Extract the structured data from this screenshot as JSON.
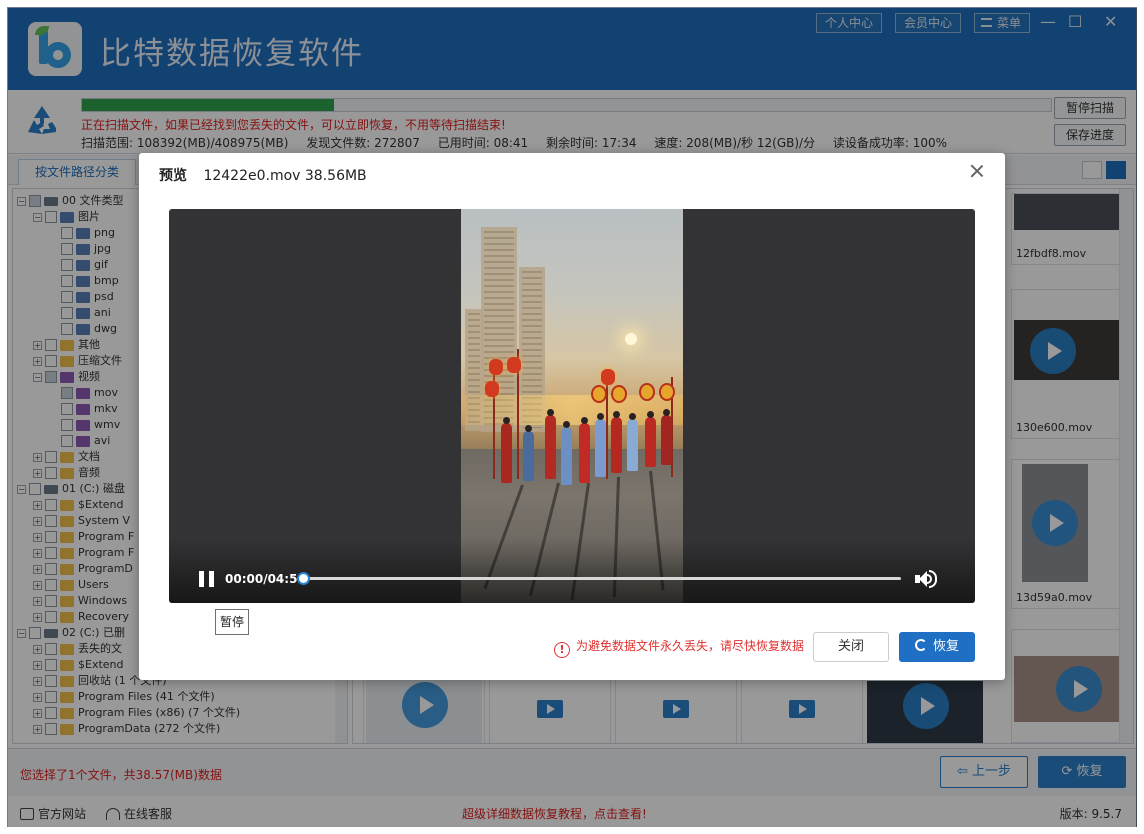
{
  "app": {
    "title": "比特数据恢复软件",
    "top_buttons": [
      "个人中心",
      "会员中心",
      "菜单"
    ],
    "window_controls": [
      "—",
      "☐",
      "✕"
    ]
  },
  "scan": {
    "progress_fraction": 0.26,
    "message": "正在扫描文件，如果已经找到您丢失的文件，可以立即恢复，不用等待扫描结束!",
    "stats": {
      "range": "扫描范围: 108392(MB)/408975(MB)",
      "found": "发现文件数: 272807",
      "elapsed": "已用时间: 08:41",
      "remaining": "剩余时间: 17:34",
      "speed": "速度: 208(MB)/秒  12(GB)/分",
      "success_rate": "读设备成功率: 100%"
    },
    "pause_button": "暂停扫描",
    "save_button": "保存进度",
    "colors": {
      "progress": "#2ea44f",
      "message": "#e02020"
    }
  },
  "tabs": {
    "active": "按文件路径分类"
  },
  "tree": [
    {
      "depth": 0,
      "label": "00 文件类型",
      "icon": "drive-icon"
    },
    {
      "depth": 1,
      "label": "图片",
      "icon": "image-icon"
    },
    {
      "depth": 2,
      "label": "png",
      "icon": "image-icon"
    },
    {
      "depth": 2,
      "label": "jpg",
      "icon": "image-icon"
    },
    {
      "depth": 2,
      "label": "gif",
      "icon": "image-icon"
    },
    {
      "depth": 2,
      "label": "bmp",
      "icon": "image-icon"
    },
    {
      "depth": 2,
      "label": "psd",
      "icon": "image-icon"
    },
    {
      "depth": 2,
      "label": "ani",
      "icon": "image-icon"
    },
    {
      "depth": 2,
      "label": "dwg",
      "icon": "image-icon"
    },
    {
      "depth": 1,
      "label": "其他",
      "icon": "folder-icon"
    },
    {
      "depth": 1,
      "label": "压缩文件",
      "icon": "folder-icon"
    },
    {
      "depth": 1,
      "label": "视频",
      "icon": "video-icon"
    },
    {
      "depth": 2,
      "label": "mov",
      "icon": "video-icon"
    },
    {
      "depth": 2,
      "label": "mkv",
      "icon": "video-icon"
    },
    {
      "depth": 2,
      "label": "wmv",
      "icon": "video-icon"
    },
    {
      "depth": 2,
      "label": "avi",
      "icon": "video-icon"
    },
    {
      "depth": 1,
      "label": "文档",
      "icon": "folder-icon"
    },
    {
      "depth": 1,
      "label": "音频",
      "icon": "folder-icon"
    },
    {
      "depth": 0,
      "label": "01 (C:) 磁盘",
      "icon": "drive-icon"
    },
    {
      "depth": 1,
      "label": "$Extend",
      "icon": "folder-icon"
    },
    {
      "depth": 1,
      "label": "System V",
      "icon": "folder-icon"
    },
    {
      "depth": 1,
      "label": "Program F",
      "icon": "folder-icon"
    },
    {
      "depth": 1,
      "label": "Program F",
      "icon": "folder-icon"
    },
    {
      "depth": 1,
      "label": "ProgramD",
      "icon": "folder-icon"
    },
    {
      "depth": 1,
      "label": "Users",
      "icon": "folder-icon"
    },
    {
      "depth": 1,
      "label": "Windows",
      "icon": "folder-icon"
    },
    {
      "depth": 1,
      "label": "Recovery",
      "icon": "folder-icon"
    },
    {
      "depth": 0,
      "label": "02 (C:) 已删",
      "icon": "drive-icon"
    },
    {
      "depth": 1,
      "label": "丢失的文",
      "icon": "folder-icon"
    },
    {
      "depth": 1,
      "label": "$Extend",
      "icon": "folder-icon"
    },
    {
      "depth": 1,
      "label": "回收站   (1 个文件)",
      "icon": "folder-icon"
    },
    {
      "depth": 1,
      "label": "Program Files    (41 个文件)",
      "icon": "folder-icon"
    },
    {
      "depth": 1,
      "label": "Program Files (x86)    (7 个文件)",
      "icon": "folder-icon"
    },
    {
      "depth": 1,
      "label": "ProgramData    (272 个文件)",
      "icon": "folder-icon"
    }
  ],
  "grid": {
    "files": [
      "12fbdf8.mov",
      "130e600.mov",
      "13d59a0.mov"
    ]
  },
  "bottom": {
    "selection_info": "您选择了1个文件，共38.57(MB)数据",
    "prev_button": "上一步",
    "recover_button": "恢复"
  },
  "footer": {
    "website": "官方网站",
    "support": "在线客服",
    "tutorial": "超级详细数据恢复教程，点击查看!",
    "version": "版本: 9.5.7"
  },
  "modal": {
    "title_label": "预览",
    "file_info": "12422e0.mov 38.56MB",
    "player": {
      "time": "00:00/04:59",
      "position_fraction": 0.0,
      "tooltip": "暂停"
    },
    "warning": "为避免数据文件永久丢失，请尽快恢复数据",
    "close_button": "关闭",
    "recover_button": "恢复",
    "colors": {
      "accent": "#1f6fc4",
      "warning": "#e03030"
    }
  }
}
